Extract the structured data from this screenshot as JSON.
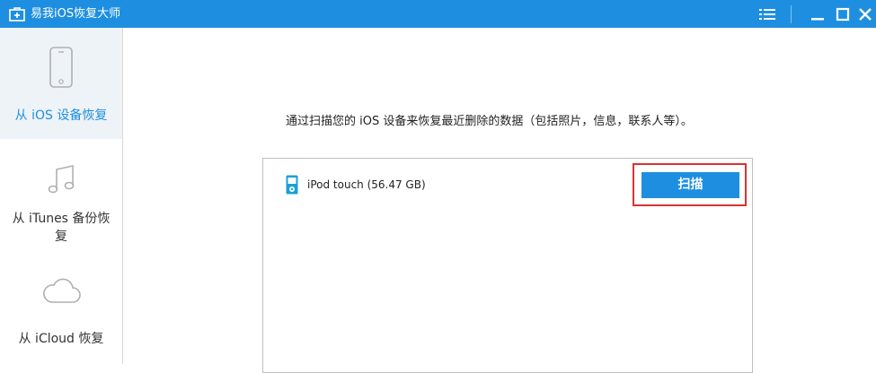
{
  "window": {
    "title": "易我iOS恢复大师",
    "app_icon": "first-aid-box-icon",
    "controls": [
      "menu-icon",
      "minimize-icon",
      "maximize-icon",
      "close-icon"
    ]
  },
  "colors": {
    "titlebar": "#1e8fe0",
    "accent": "#1e8fe0",
    "highlight_border": "#d9322e",
    "active_nav_bg": "#eef3f8"
  },
  "sidebar": {
    "items": [
      {
        "label": "从 iOS 设备恢复",
        "icon": "iphone-icon",
        "active": true
      },
      {
        "label_line1": "从 iTunes 备份恢",
        "label_line2": "复",
        "icon": "music-note-icon",
        "active": false
      },
      {
        "label": "从 iCloud 恢复",
        "icon": "cloud-icon",
        "active": false
      }
    ]
  },
  "main": {
    "prompt": "通过扫描您的 iOS 设备来恢复最近删除的数据（包括照片，信息，联系人等）。",
    "device": {
      "name": "iPod touch (56.47 GB)",
      "icon": "ipod-icon"
    },
    "scan_button_label": "扫描"
  }
}
